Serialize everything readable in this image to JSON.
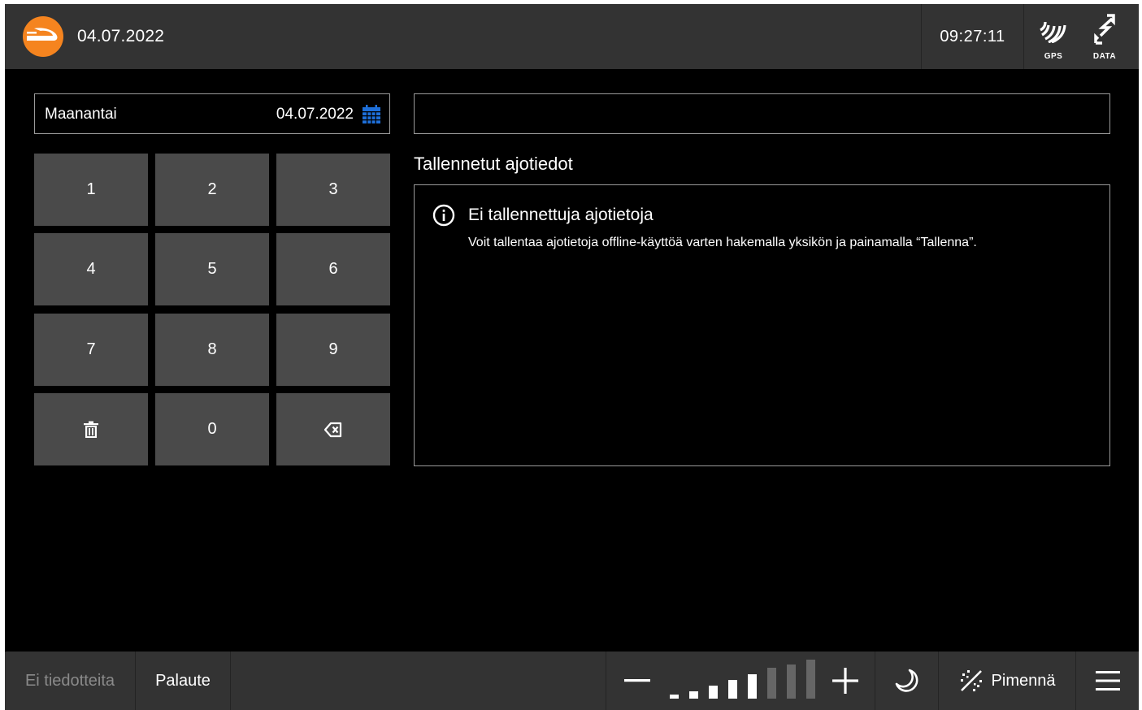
{
  "header": {
    "date": "04.07.2022",
    "time": "09:27:11",
    "gps_label": "GPS",
    "data_label": "DATA",
    "brand_color": "#f5841f"
  },
  "date_field": {
    "weekday": "Maanantai",
    "date": "04.07.2022",
    "calendar_icon": "calendar-icon",
    "calendar_color": "#1e6fd9"
  },
  "keypad": {
    "keys": [
      "1",
      "2",
      "3",
      "4",
      "5",
      "6",
      "7",
      "8",
      "9",
      "trash-icon",
      "0",
      "backspace-icon"
    ]
  },
  "unit_input": {
    "value": ""
  },
  "saved_trips": {
    "title": "Tallennetut ajotiedot",
    "empty_title": "Ei tallennettuja ajotietoja",
    "empty_text": "Voit tallentaa ajotietoja offline-käyttöä varten hakemalla yksikön ja painamalla “Tallenna”."
  },
  "footer": {
    "notices": "Ei tiedotteita",
    "feedback": "Palaute",
    "brightness_level": 5,
    "brightness_max": 8,
    "dim_label": "Pimennä",
    "icons": [
      "minus-icon",
      "plus-icon",
      "moon-icon",
      "dim-icon",
      "hamburger-menu-icon"
    ]
  }
}
